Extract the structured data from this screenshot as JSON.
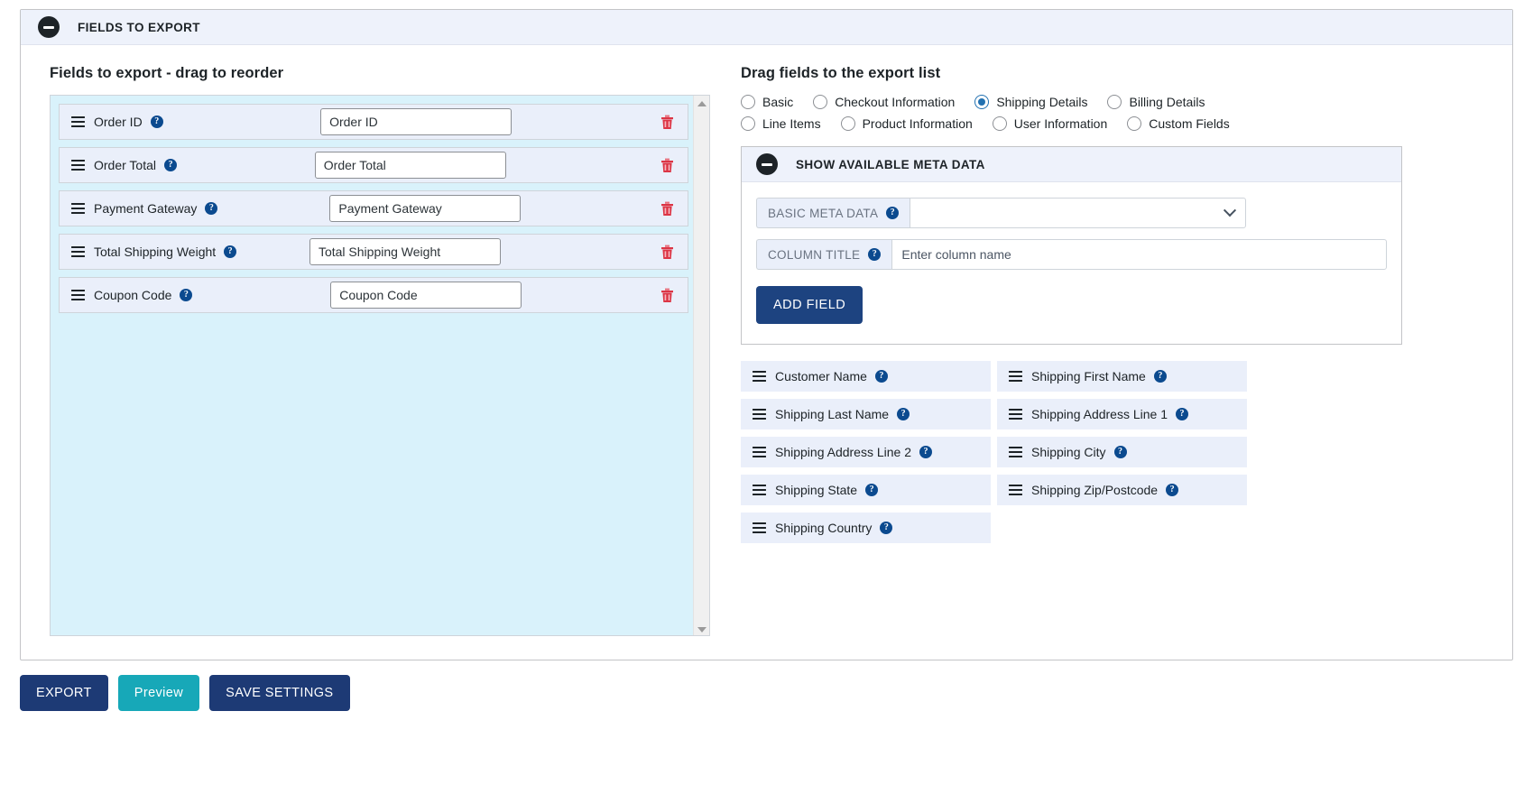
{
  "panel": {
    "title": "FIELDS TO EXPORT",
    "collapse_icon": "minus-circle-icon"
  },
  "left": {
    "heading": "Fields to export - drag to reorder",
    "rows": [
      {
        "label": "Order ID",
        "value": "Order ID",
        "help": "?",
        "delete_icon": "trash-icon"
      },
      {
        "label": "Order Total",
        "value": "Order Total",
        "help": "?",
        "delete_icon": "trash-icon"
      },
      {
        "label": "Payment Gateway",
        "value": "Payment Gateway",
        "help": "?",
        "delete_icon": "trash-icon"
      },
      {
        "label": "Total Shipping Weight",
        "value": "Total Shipping Weight",
        "help": "?",
        "delete_icon": "trash-icon"
      },
      {
        "label": "Coupon Code",
        "value": "Coupon Code",
        "help": "?",
        "delete_icon": "trash-icon"
      }
    ]
  },
  "right": {
    "heading": "Drag fields to the export list",
    "radios_row1": [
      {
        "label": "Basic",
        "checked": false
      },
      {
        "label": "Checkout Information",
        "checked": false
      },
      {
        "label": "Shipping Details",
        "checked": true
      },
      {
        "label": "Billing Details",
        "checked": false
      }
    ],
    "radios_row2": [
      {
        "label": "Line Items",
        "checked": false
      },
      {
        "label": "Product Information",
        "checked": false
      },
      {
        "label": "User Information",
        "checked": false
      },
      {
        "label": "Custom Fields",
        "checked": false
      }
    ],
    "meta": {
      "title": "SHOW AVAILABLE META DATA",
      "collapse_icon": "minus-circle-icon",
      "basic_meta_label": "BASIC META DATA",
      "basic_meta_value": "",
      "basic_meta_help": "?",
      "column_title_label": "COLUMN TITLE",
      "column_title_help": "?",
      "column_title_value": "",
      "column_title_placeholder": "Enter column name",
      "add_field_label": "ADD FIELD"
    },
    "available_fields": [
      {
        "label": "Customer Name",
        "help": "?"
      },
      {
        "label": "Shipping First Name",
        "help": "?"
      },
      {
        "label": "Shipping Last Name",
        "help": "?"
      },
      {
        "label": "Shipping Address Line 1",
        "help": "?"
      },
      {
        "label": "Shipping Address Line 2",
        "help": "?"
      },
      {
        "label": "Shipping City",
        "help": "?"
      },
      {
        "label": "Shipping State",
        "help": "?"
      },
      {
        "label": "Shipping Zip/Postcode",
        "help": "?"
      },
      {
        "label": "Shipping Country",
        "help": "?"
      }
    ]
  },
  "footer": {
    "export_label": "EXPORT",
    "preview_label": "Preview",
    "save_label": "SAVE SETTINGS"
  },
  "colors": {
    "accent_navy": "#1d3a75",
    "teal": "#17a8b8",
    "row_bg": "#eaeffa",
    "dropzone_bg": "#d9f2fb",
    "header_bg": "#eef2fb",
    "help_blue": "#0b4a8f",
    "trash_red": "#dc3545",
    "radio_checked": "#2271b1"
  }
}
